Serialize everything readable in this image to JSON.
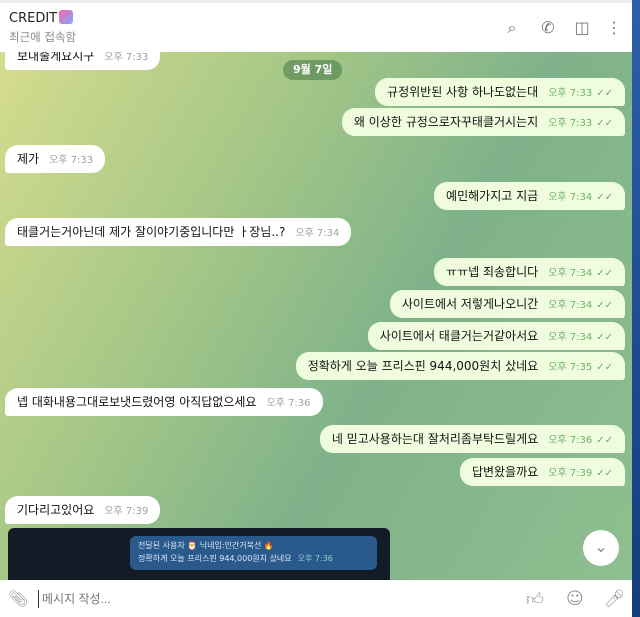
{
  "header": {
    "title": "CREDIT",
    "status": "최근에 접속함",
    "icons": [
      "search-icon",
      "phone-icon",
      "sidebar-toggle-icon",
      "more-vertical-icon"
    ]
  },
  "date_chip": "9월 7일",
  "messages": [
    {
      "dir": "in",
      "text": "보내줄게요시구",
      "time": "오후 7:33"
    },
    {
      "dir": "out",
      "text": "규정위반된 사항 하나도없는대",
      "time": "오후 7:33"
    },
    {
      "dir": "out",
      "text": "왜 이상한 규정으로자꾸태클거시는지",
      "time": "오후 7:33"
    },
    {
      "dir": "in",
      "text": "제가",
      "time": "오후 7:33"
    },
    {
      "dir": "out",
      "text": "예민해가지고 지금",
      "time": "오후 7:34"
    },
    {
      "dir": "in",
      "text": "태클거는거아닌데 제가 잘이야기중입니다만 ㅏ장님..?",
      "time": "오후 7:34"
    },
    {
      "dir": "out",
      "text": "ㅠㅠ넵 죄송합니다",
      "time": "오후 7:34"
    },
    {
      "dir": "out",
      "text": "사이트에서 저렇게나오니간",
      "time": "오후 7:34"
    },
    {
      "dir": "out",
      "text": "사이트에서 태클거는거같아서요",
      "time": "오후 7:34"
    },
    {
      "dir": "out",
      "text": "정확하게 오늘 프리스핀 944,000원치 샀네요",
      "time": "오후 7:35"
    },
    {
      "dir": "in",
      "text": "넵 대화내용그대로보냇드렸어영 아직답없으세요",
      "time": "오후 7:36"
    },
    {
      "dir": "out",
      "text": "네 믿고사용하는대 잘처리좀부탁드릴게요",
      "time": "오후 7:36"
    },
    {
      "dir": "out",
      "text": "답변왔을까요",
      "time": "오후 7:39"
    },
    {
      "dir": "in",
      "text": "기다리고있어요",
      "time": "오후 7:39"
    }
  ],
  "forwarded": {
    "header": "전달된 사용자 🎅 닉네임:인간거북선 🔥",
    "text": "정확하게 오늘 프리스핀 944,000원치 샀네요",
    "time": "오후 7:36"
  },
  "input": {
    "placeholder": "메시지 작성..."
  },
  "checkmark": "✓✓"
}
